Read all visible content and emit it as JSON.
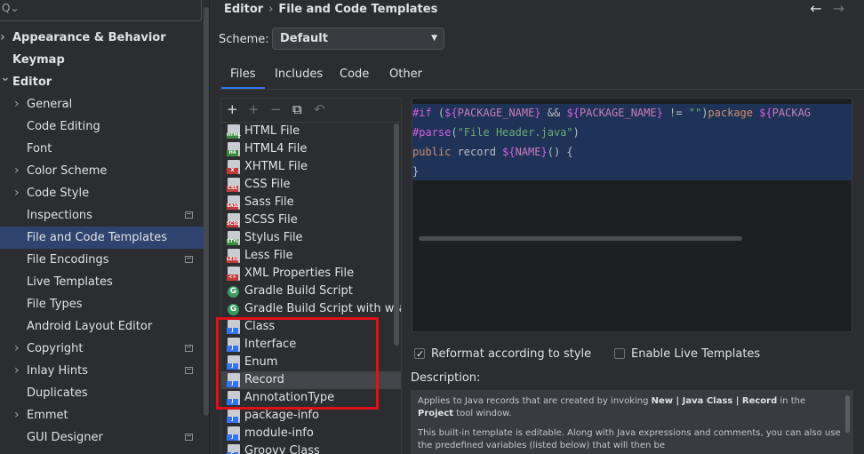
{
  "sidebar": {
    "search_placeholder": "",
    "items": [
      {
        "label": "Appearance & Behavior",
        "bold": true,
        "arrow": true,
        "level": 0
      },
      {
        "label": "Keymap",
        "bold": true,
        "arrow": false,
        "level": 0
      },
      {
        "label": "Editor",
        "bold": true,
        "arrow": "open",
        "level": 0
      },
      {
        "label": "General",
        "arrow": true,
        "level": 1
      },
      {
        "label": "Code Editing",
        "level": 1
      },
      {
        "label": "Font",
        "level": 1
      },
      {
        "label": "Color Scheme",
        "arrow": true,
        "level": 1
      },
      {
        "label": "Code Style",
        "arrow": true,
        "level": 1
      },
      {
        "label": "Inspections",
        "level": 1,
        "project": true
      },
      {
        "label": "File and Code Templates",
        "level": 1,
        "selected": true
      },
      {
        "label": "File Encodings",
        "level": 1,
        "project": true
      },
      {
        "label": "Live Templates",
        "level": 1
      },
      {
        "label": "File Types",
        "level": 1
      },
      {
        "label": "Android Layout Editor",
        "level": 1
      },
      {
        "label": "Copyright",
        "arrow": true,
        "level": 1,
        "project": true
      },
      {
        "label": "Inlay Hints",
        "arrow": true,
        "level": 1,
        "project": true
      },
      {
        "label": "Duplicates",
        "level": 1
      },
      {
        "label": "Emmet",
        "arrow": true,
        "level": 1
      },
      {
        "label": "GUI Designer",
        "level": 1,
        "project": true
      }
    ]
  },
  "header": {
    "crumb_root": "Editor",
    "crumb_sep": "›",
    "crumb_page": "File and Code Templates",
    "back_arrow": "←",
    "forward_arrow": "→"
  },
  "scheme": {
    "label": "Scheme:",
    "value": "Default"
  },
  "tabs": [
    "Files",
    "Includes",
    "Code",
    "Other"
  ],
  "toolbar": {
    "add": "+",
    "remove": "−",
    "copy": "⧉",
    "reset": "↶",
    "add_child": "+"
  },
  "templates": [
    {
      "name": "HTML File",
      "icon": "html-file-icon",
      "tag": "HTML",
      "color": "#3a8d3e"
    },
    {
      "name": "HTML4 File",
      "icon": "html-file-icon",
      "tag": "H4",
      "color": "#3a8d3e"
    },
    {
      "name": "XHTML File",
      "icon": "xhtml-file-icon",
      "tag": "X",
      "color": "#c03c3c"
    },
    {
      "name": "CSS File",
      "icon": "css-file-icon",
      "tag": "CSS",
      "color": "#c03c3c"
    },
    {
      "name": "Sass File",
      "icon": "sass-file-icon",
      "tag": "SASS",
      "color": "#c03c3c"
    },
    {
      "name": "SCSS File",
      "icon": "scss-file-icon",
      "tag": "SCSS",
      "color": "#c03c3c"
    },
    {
      "name": "Stylus File",
      "icon": "stylus-file-icon",
      "tag": "STYL",
      "color": "#3a8d3e"
    },
    {
      "name": "Less File",
      "icon": "less-file-icon",
      "tag": "LESS",
      "color": "#c03c3c"
    },
    {
      "name": "XML Properties File",
      "icon": "xml-file-icon",
      "tag": "<>",
      "color": "#c03c3c"
    },
    {
      "name": "Gradle Build Script",
      "icon": "gradle-icon",
      "tag": "G",
      "color": "#3b9a5f"
    },
    {
      "name": "Gradle Build Script with wrapp",
      "icon": "gradle-icon",
      "tag": "G",
      "color": "#3b9a5f"
    },
    {
      "name": "Class",
      "icon": "java-file-icon",
      "tag": "J",
      "color": "#3574f0"
    },
    {
      "name": "Interface",
      "icon": "java-file-icon",
      "tag": "J",
      "color": "#3574f0"
    },
    {
      "name": "Enum",
      "icon": "java-file-icon",
      "tag": "J",
      "color": "#3574f0"
    },
    {
      "name": "Record",
      "icon": "java-file-icon",
      "tag": "J",
      "color": "#3574f0",
      "selected": true
    },
    {
      "name": "AnnotationType",
      "icon": "java-file-icon",
      "tag": "J",
      "color": "#3574f0"
    },
    {
      "name": "package-info",
      "icon": "java-file-icon",
      "tag": "J",
      "color": "#3574f0"
    },
    {
      "name": "module-info",
      "icon": "java-file-icon",
      "tag": "J",
      "color": "#3574f0"
    },
    {
      "name": "Groovy Class",
      "icon": "groovy-file-icon",
      "tag": "G",
      "color": "#3574f0"
    }
  ],
  "editor": {
    "line1_a": "#if",
    "line1_b": " (",
    "line1_c": "${",
    "line1_d": "PACKAGE_NAME",
    "line1_e": "}",
    "line1_f": " && ",
    "line1_g": "${",
    "line1_h": "PACKAGE_NAME",
    "line1_i": "}",
    "line1_j": " != ",
    "line1_k": "\"\"",
    "line1_l": ")",
    "line1_m": "package ",
    "line1_n": "${",
    "line1_o": "PACKAG",
    "line2_a": "#parse",
    "line2_b": "(",
    "line2_c": "\"File Header.java\"",
    "line2_d": ")",
    "line3_a": "public",
    "line3_b": " record ",
    "line3_c": "${",
    "line3_d": "NAME",
    "line3_e": "}",
    "line3_f": "() {",
    "line4": "}"
  },
  "options": {
    "reformat_label": "Reformat according to style",
    "reformat_checked": true,
    "live_label": "Enable Live Templates",
    "live_checked": false
  },
  "description": {
    "label": "Description:",
    "p1_a": "Applies to Java records that are created by invoking ",
    "p1_b": "New | Java Class | Record",
    "p1_c": " in the ",
    "p1_d": "Project",
    "p1_e": " tool window.",
    "p2": "This built-in template is editable. Along with Java expressions and comments, you can also use the predefined variables (listed below) that will then be"
  }
}
